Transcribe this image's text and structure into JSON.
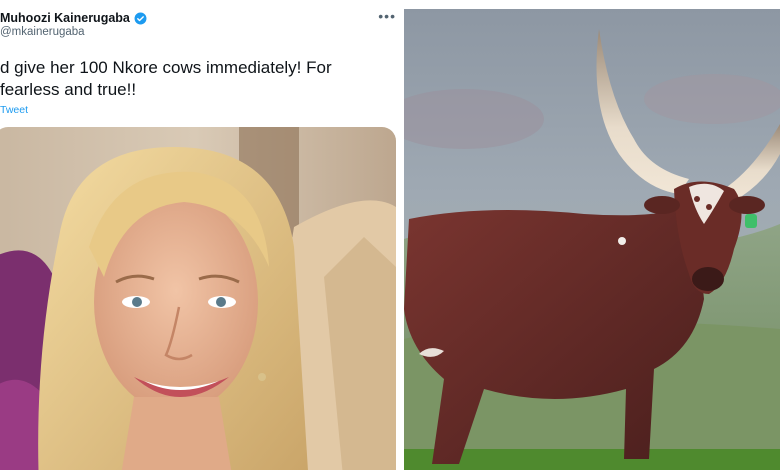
{
  "tweet": {
    "author_name": "Muhoozi Kainerugaba",
    "handle": "@mkainerugaba",
    "text_line_1": "d give her 100 Nkore cows immediately! For",
    "text_line_2": "fearless and true!!",
    "link_text": "Tweet",
    "more_glyph": "•••"
  },
  "icons": {
    "verified": "verified-badge-icon",
    "more": "more-options-icon"
  },
  "colors": {
    "accent": "#1d9bf0",
    "text": "#0f1419",
    "secondary": "#536471"
  }
}
